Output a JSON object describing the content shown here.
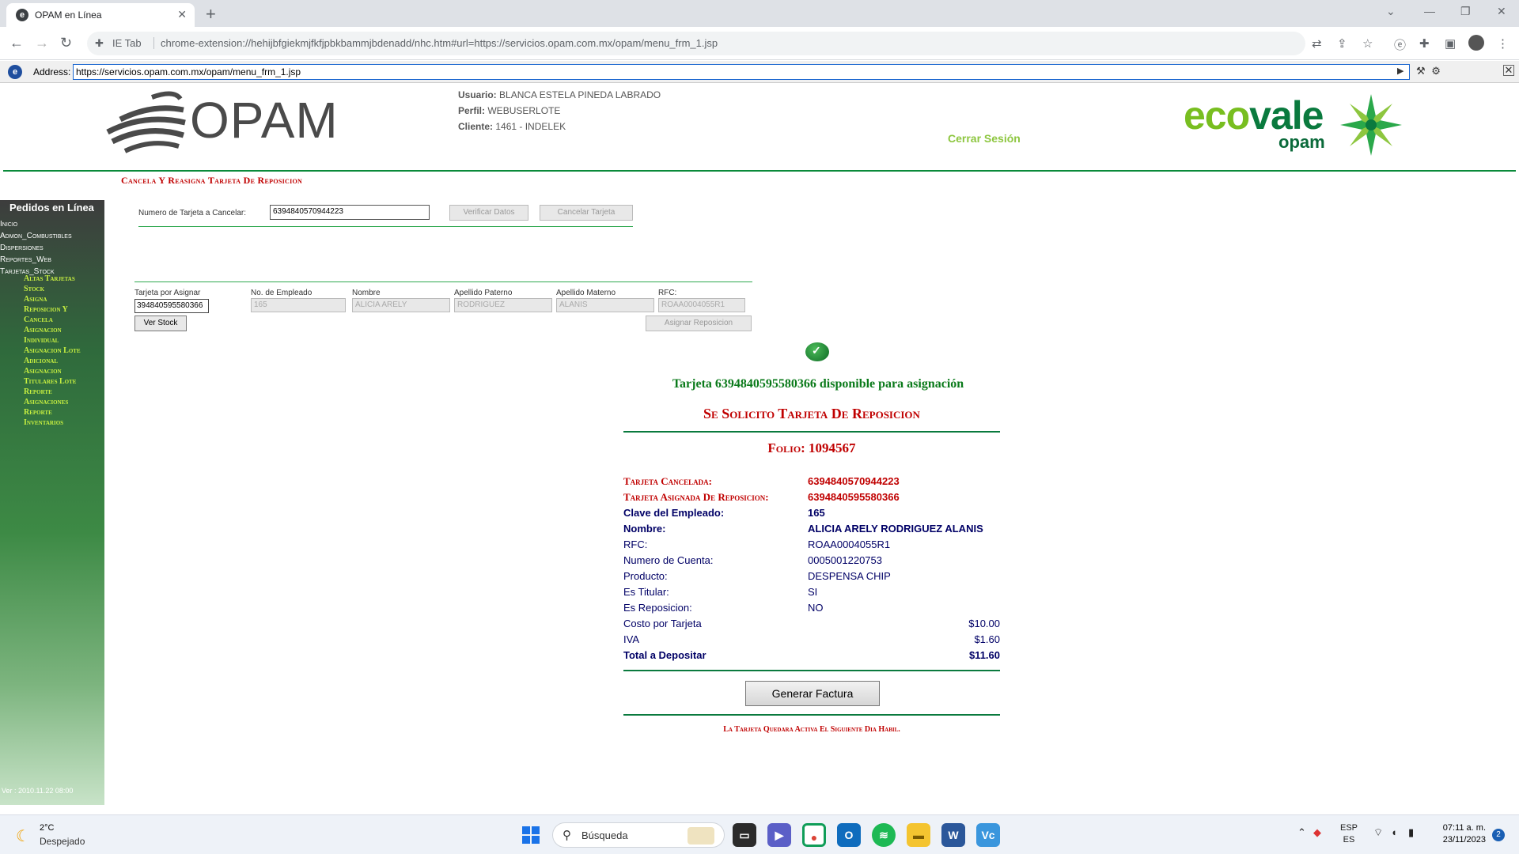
{
  "browser": {
    "tab_title": "OPAM en Línea",
    "ie_tab_label": "IE Tab",
    "url": "chrome-extension://hehijbfgiekmjfkfjpbkbammjbdenadd/nhc.htm#url=https://servicios.opam.com.mx/opam/menu_frm_1.jsp",
    "ie_address_label": "Address:",
    "ie_address": "https://servicios.opam.com.mx/opam/menu_frm_1.jsp"
  },
  "header": {
    "logo_text": "OPAM",
    "user_label": "Usuario:",
    "user_value": "BLANCA ESTELA PINEDA LABRADO",
    "profile_label": "Perfil:",
    "profile_value": "WEBUSERLOTE",
    "client_label": "Cliente:",
    "client_value": "1461 - INDELEK",
    "logout": "Cerrar Sesión",
    "brand_eco": "eco",
    "brand_vale": "vale",
    "brand_sub": "opam"
  },
  "page_title": "Cancela Y Reasigna Tarjeta De Reposicion",
  "sidebar": {
    "heading": "Pedidos en Línea",
    "items": [
      "Inicio",
      "Admon_Combustibles",
      "Dispersiones",
      "Reportes_Web",
      "Tarjetas_Stock"
    ],
    "subitems": [
      "Altas Tarjetas",
      "Stock",
      "Asigna",
      "Reposicion Y",
      "Cancela",
      "Asignacion",
      "Individual",
      "Asignacion Lote",
      "Adicional",
      "Asignacion",
      "Titulares Lote",
      "Reporte",
      "Asignaciones",
      "Reporte",
      "Inventarios"
    ],
    "version": "Ver : 2010.11.22 08:00"
  },
  "cancel_form": {
    "label": "Numero de Tarjeta a Cancelar:",
    "value": "6394840570944223",
    "verify_btn": "Verificar Datos",
    "cancel_btn": "Cancelar Tarjeta"
  },
  "assign_form": {
    "card_label": "Tarjeta por Asignar",
    "card_value": "394840595580366",
    "employee_label": "No. de Empleado",
    "employee_value": "165",
    "name_label": "Nombre",
    "name_value": "ALICIA ARELY",
    "paterno_label": "Apellido Paterno",
    "paterno_value": "RODRIGUEZ",
    "materno_label": "Apellido Materno",
    "materno_value": "ALANIS",
    "rfc_label": "RFC:",
    "rfc_value": "ROAA0004055R1",
    "stock_btn": "Ver Stock",
    "assign_btn": "Asignar Reposicion"
  },
  "result": {
    "available_msg": "Tarjeta 6394840595580366 disponible para asignación",
    "requested_title": "Se Solicito Tarjeta De Reposicion",
    "folio": "Folio: 1094567",
    "cancelled_label": "Tarjeta Cancelada:",
    "cancelled_value": "6394840570944223",
    "assigned_label": "Tarjeta Asignada De Reposicion:",
    "assigned_value": "6394840595580366",
    "employee_key_label": "Clave del Empleado:",
    "employee_key_value": "165",
    "name_label": "Nombre:",
    "name_value": "ALICIA ARELY RODRIGUEZ ALANIS",
    "rfc_label": "RFC:",
    "rfc_value": "ROAA0004055R1",
    "account_label": "Numero de Cuenta:",
    "account_value": "0005001220753",
    "product_label": "Producto:",
    "product_value": "DESPENSA CHIP",
    "titular_label": "Es Titular:",
    "titular_value": "SI",
    "reposicion_label": "Es Reposicion:",
    "reposicion_value": "NO",
    "cost_label": "Costo por Tarjeta",
    "cost_value": "$10.00",
    "iva_label": "IVA",
    "iva_value": "$1.60",
    "total_label": "Total a Depositar",
    "total_value": "$11.60",
    "invoice_btn": "Generar Factura",
    "footnote": "La Tarjeta Quedara Activa El Siguiente Dia Habil."
  },
  "taskbar": {
    "temperature": "2°C",
    "weather": "Despejado",
    "search_placeholder": "Búsqueda",
    "lang1": "ESP",
    "lang2": "ES",
    "time": "07:11 a. m.",
    "date": "23/11/2023",
    "notifications": "2"
  }
}
